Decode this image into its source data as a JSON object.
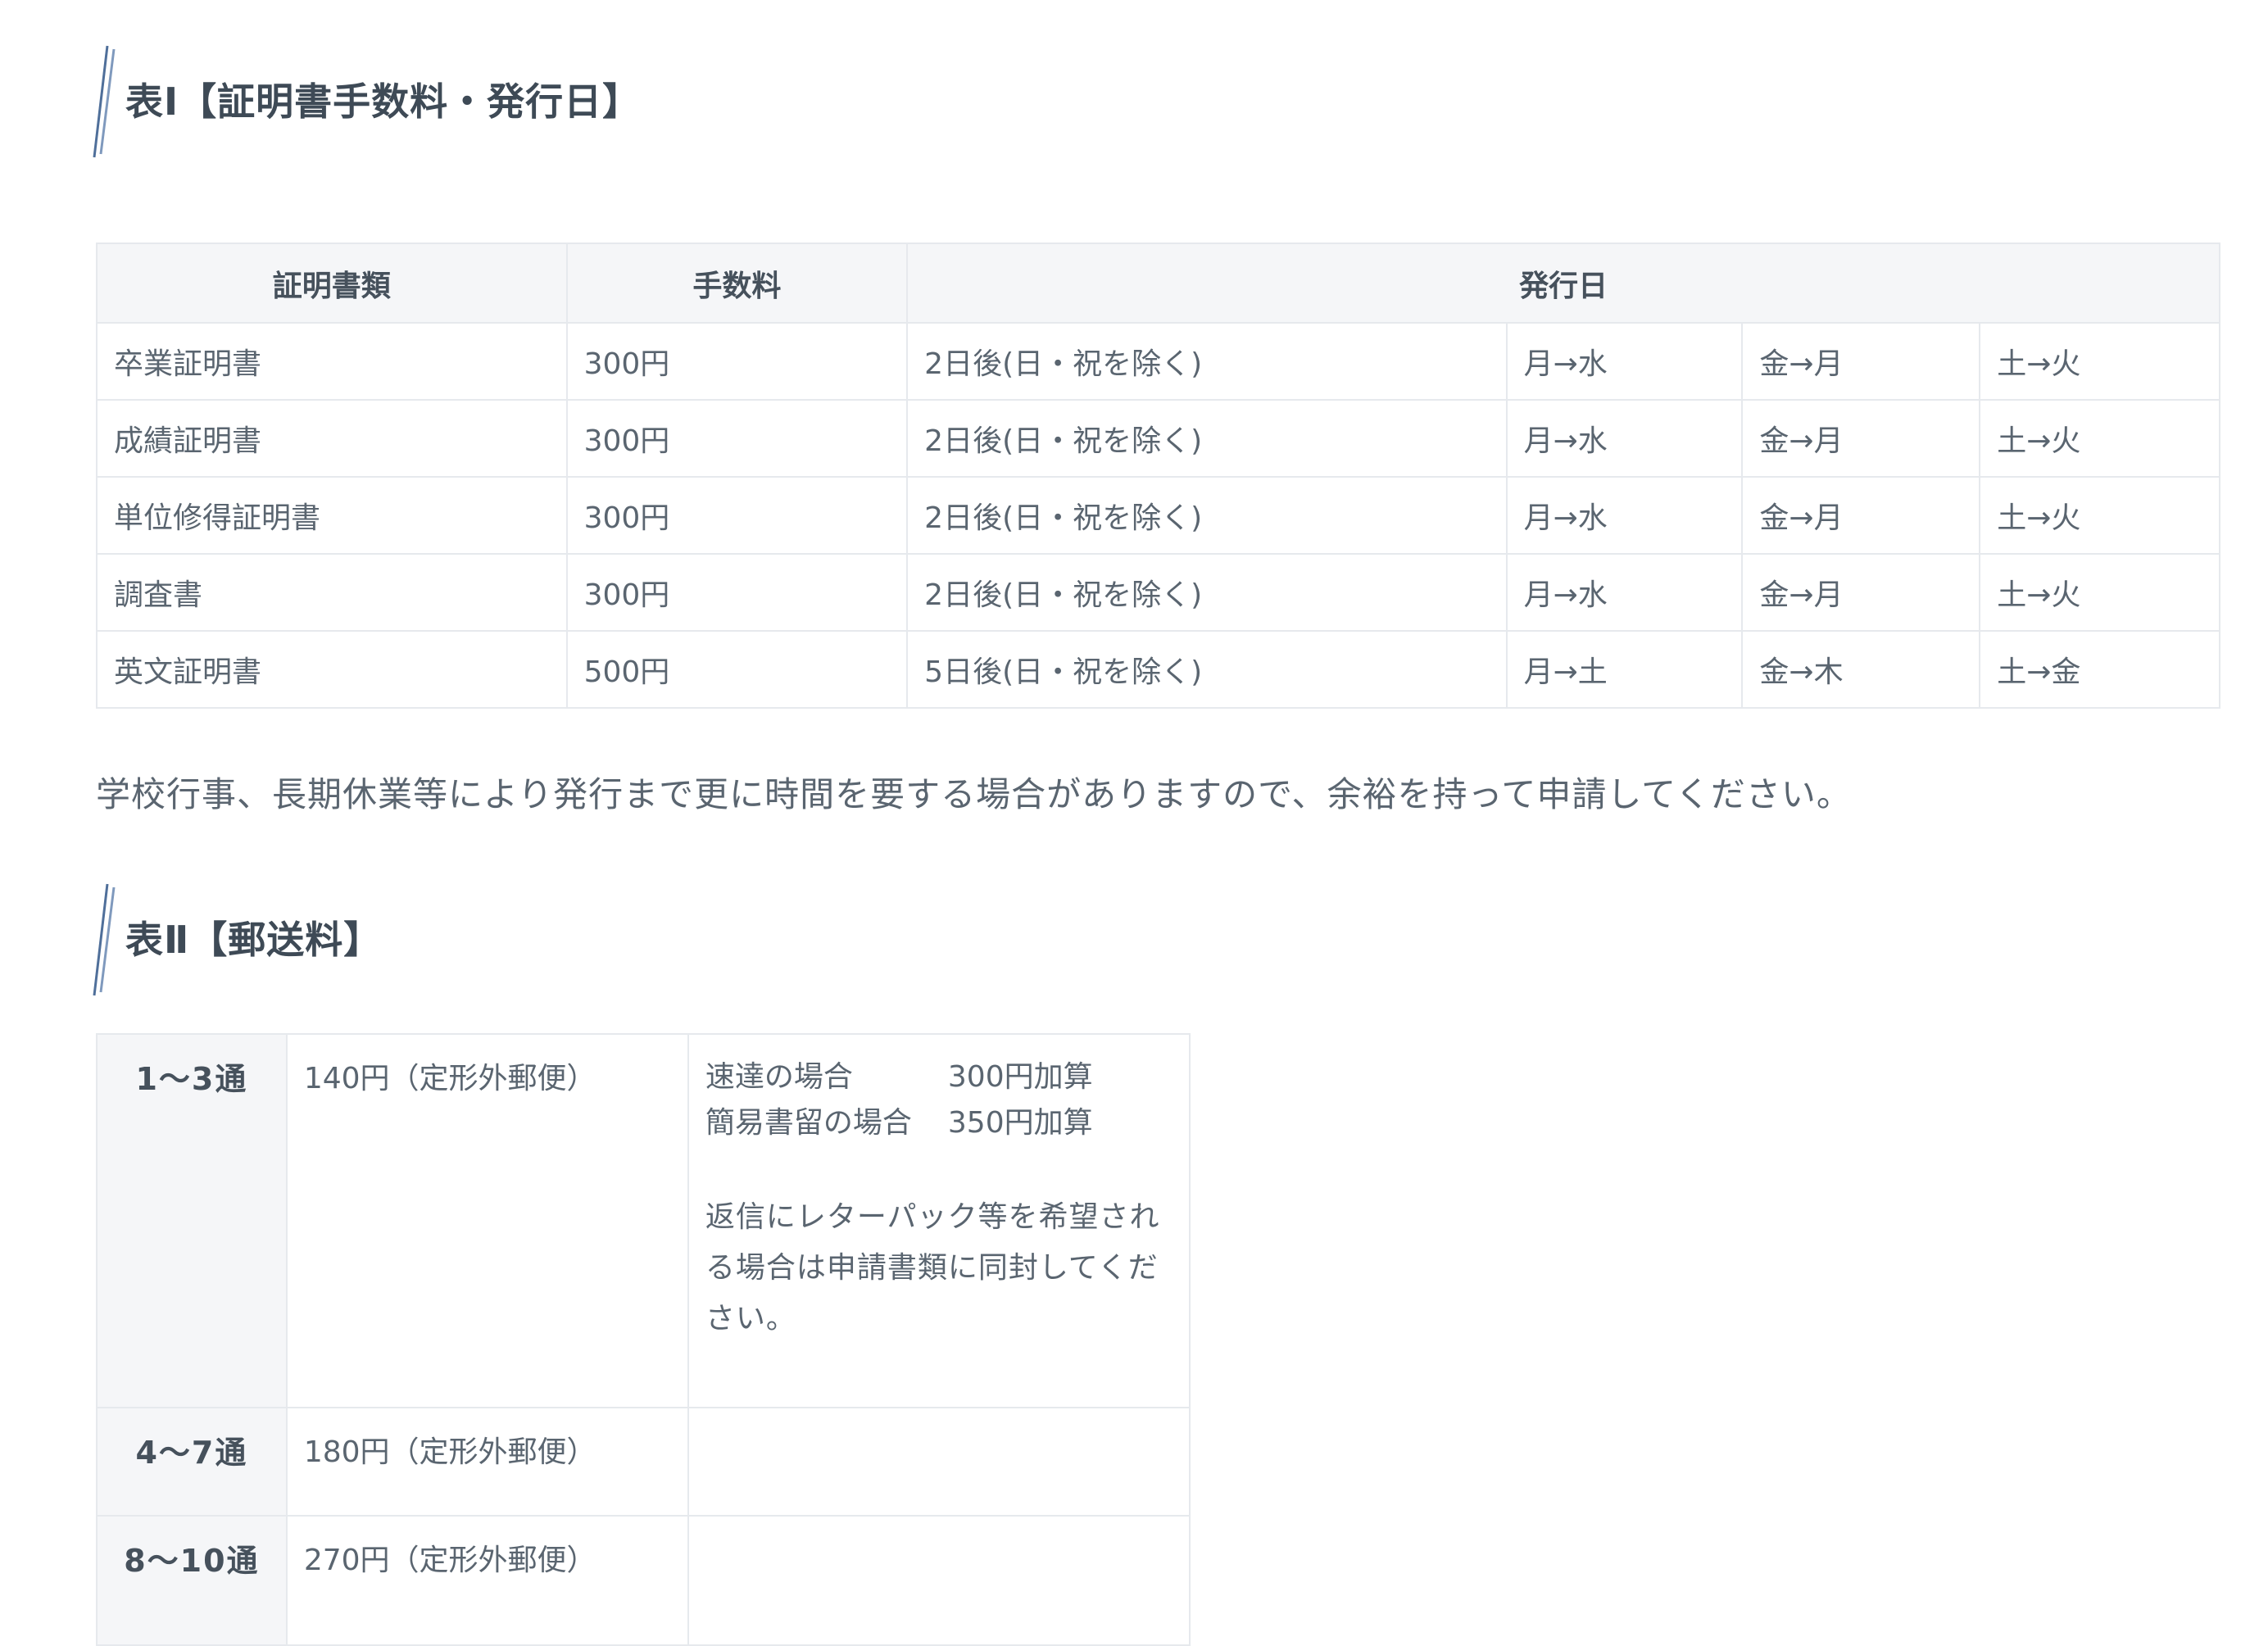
{
  "table1": {
    "heading": "表Ⅰ【証明書手数料・発行日】",
    "headers": [
      "証明書類",
      "手数料",
      "発行日"
    ],
    "rows": [
      {
        "type": "卒業証明書",
        "fee": "300円",
        "issue": "2日後(日・祝を除く)",
        "mon": "月→水",
        "fri": "金→月",
        "sat": "土→火"
      },
      {
        "type": "成績証明書",
        "fee": "300円",
        "issue": "2日後(日・祝を除く)",
        "mon": "月→水",
        "fri": "金→月",
        "sat": "土→火"
      },
      {
        "type": "単位修得証明書",
        "fee": "300円",
        "issue": "2日後(日・祝を除く)",
        "mon": "月→水",
        "fri": "金→月",
        "sat": "土→火"
      },
      {
        "type": "調査書",
        "fee": "300円",
        "issue": "2日後(日・祝を除く)",
        "mon": "月→水",
        "fri": "金→月",
        "sat": "土→火"
      },
      {
        "type": "英文証明書",
        "fee": "500円",
        "issue": "5日後(日・祝を除く)",
        "mon": "月→土",
        "fri": "金→木",
        "sat": "土→金"
      }
    ]
  },
  "notice": "学校行事、長期休業等により発行まで更に時間を要する場合がありますので、余裕を持って申請してください。",
  "table2": {
    "heading": "表Ⅱ【郵送料】",
    "rows": [
      {
        "count": "1～3通",
        "price": "140円（定形外郵便）"
      },
      {
        "count": "4～7通",
        "price": "180円（定形外郵便）"
      },
      {
        "count": "8～10通",
        "price": "270円（定形外郵便）"
      }
    ],
    "options": [
      {
        "label": "速達の場合",
        "value": "300円加算"
      },
      {
        "label": "簡易書留の場合",
        "value": "350円加算"
      }
    ],
    "note": "返信にレターパック等を希望される場合は申請書類に同封してください。"
  },
  "colors": {
    "text": "#5a6570",
    "heading": "#3e4a56",
    "border": "#e6e9ed",
    "header_bg": "#f5f6f8",
    "mark": "#4f6f9a"
  }
}
